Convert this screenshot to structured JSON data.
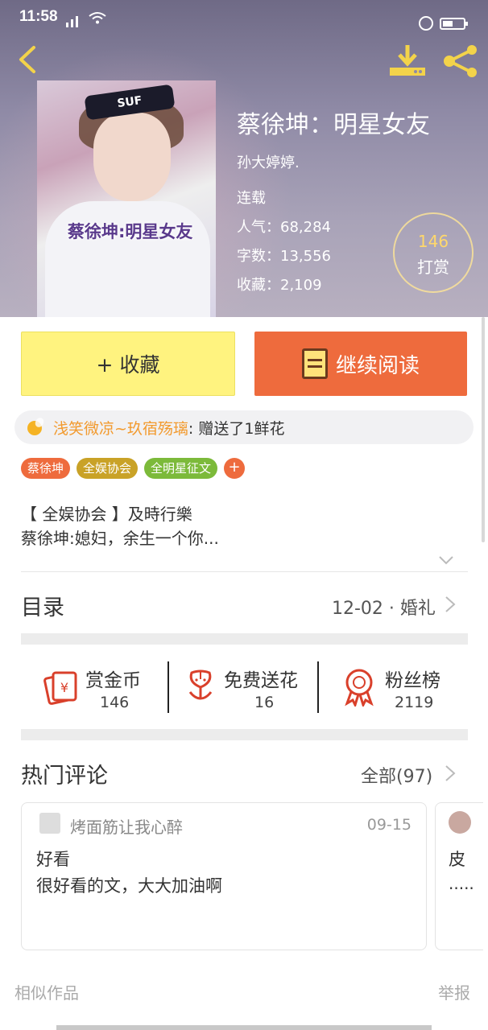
{
  "status_bar": {
    "time": "11:58",
    "network": "4G"
  },
  "book": {
    "title": "蔡徐坤：明星女友",
    "cover_text": "蔡徐坤:明星女友",
    "cover_band": "SUF",
    "author": "孙大婷婷.",
    "status": "连载",
    "popularity": "人气：68,284",
    "word_count": "字数：13,556",
    "favorites": "收藏：2,109"
  },
  "reward": {
    "count": "146",
    "label": "打赏"
  },
  "actions": {
    "collect_label": "+ 收藏",
    "read_label": "继续阅读"
  },
  "gift": {
    "user": "浅笑微凉~玖宿殇璃",
    "text": " : 赠送了1鲜花"
  },
  "tags": [
    {
      "label": "蔡徐坤",
      "color": "#ee6b3d"
    },
    {
      "label": "全娱协会",
      "color": "#c9a227"
    },
    {
      "label": "全明星征文",
      "color": "#7cba3a"
    }
  ],
  "tag_add": "+",
  "description": {
    "line1": "【 全娱协会 】及時行樂",
    "line2": "蔡徐坤:媳妇，余生一个你..."
  },
  "toc": {
    "title": "目录",
    "latest": "12-02 · 婚礼"
  },
  "stats": [
    {
      "label": "赏金币",
      "value": "146",
      "icon": "coin-icon"
    },
    {
      "label": "免费送花",
      "value": "16",
      "icon": "flower-icon"
    },
    {
      "label": "粉丝榜",
      "value": "2119",
      "icon": "badge-icon"
    }
  ],
  "hot_comments": {
    "title": "热门评论",
    "all_label": "全部(97)"
  },
  "comments": [
    {
      "user": "烤面筋让我心醉",
      "date": "09-15",
      "title": "好看",
      "body": "很好看的文，大大加油啊"
    },
    {
      "title": "皮",
      "body": "....."
    }
  ],
  "footer": {
    "similar": "相似作品",
    "report": "举报"
  },
  "colors": {
    "accent": "#ee6b3d",
    "collect_bg": "#fff37f",
    "gift_user": "#f29a2e",
    "stat_icon": "#d9402b"
  }
}
